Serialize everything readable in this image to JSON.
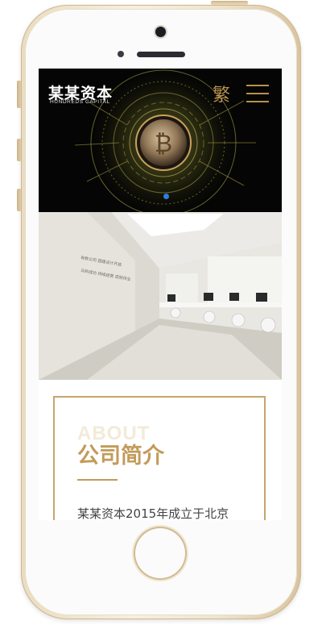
{
  "header": {
    "logo_title": "某某资本",
    "logo_subtitle": "HUNDREDS CAPITAL",
    "lang_toggle": "繁",
    "menu_icon": "hamburger-menu-icon"
  },
  "hero": {
    "slide_count": 1,
    "active_slide": 1,
    "indicator_color": "#2f7de0",
    "coin_letter": "₿"
  },
  "office_image": {
    "wall_text_1": "有数公司 圆建设计开放",
    "wall_text_2": "马到成功 持续经营 成就伟业"
  },
  "about": {
    "watermark": "ABOUT",
    "title": "公司简介",
    "text": "某某资本2015年成立于北京"
  },
  "colors": {
    "accent": "#c29b5a",
    "hero_bg": "#050505"
  }
}
